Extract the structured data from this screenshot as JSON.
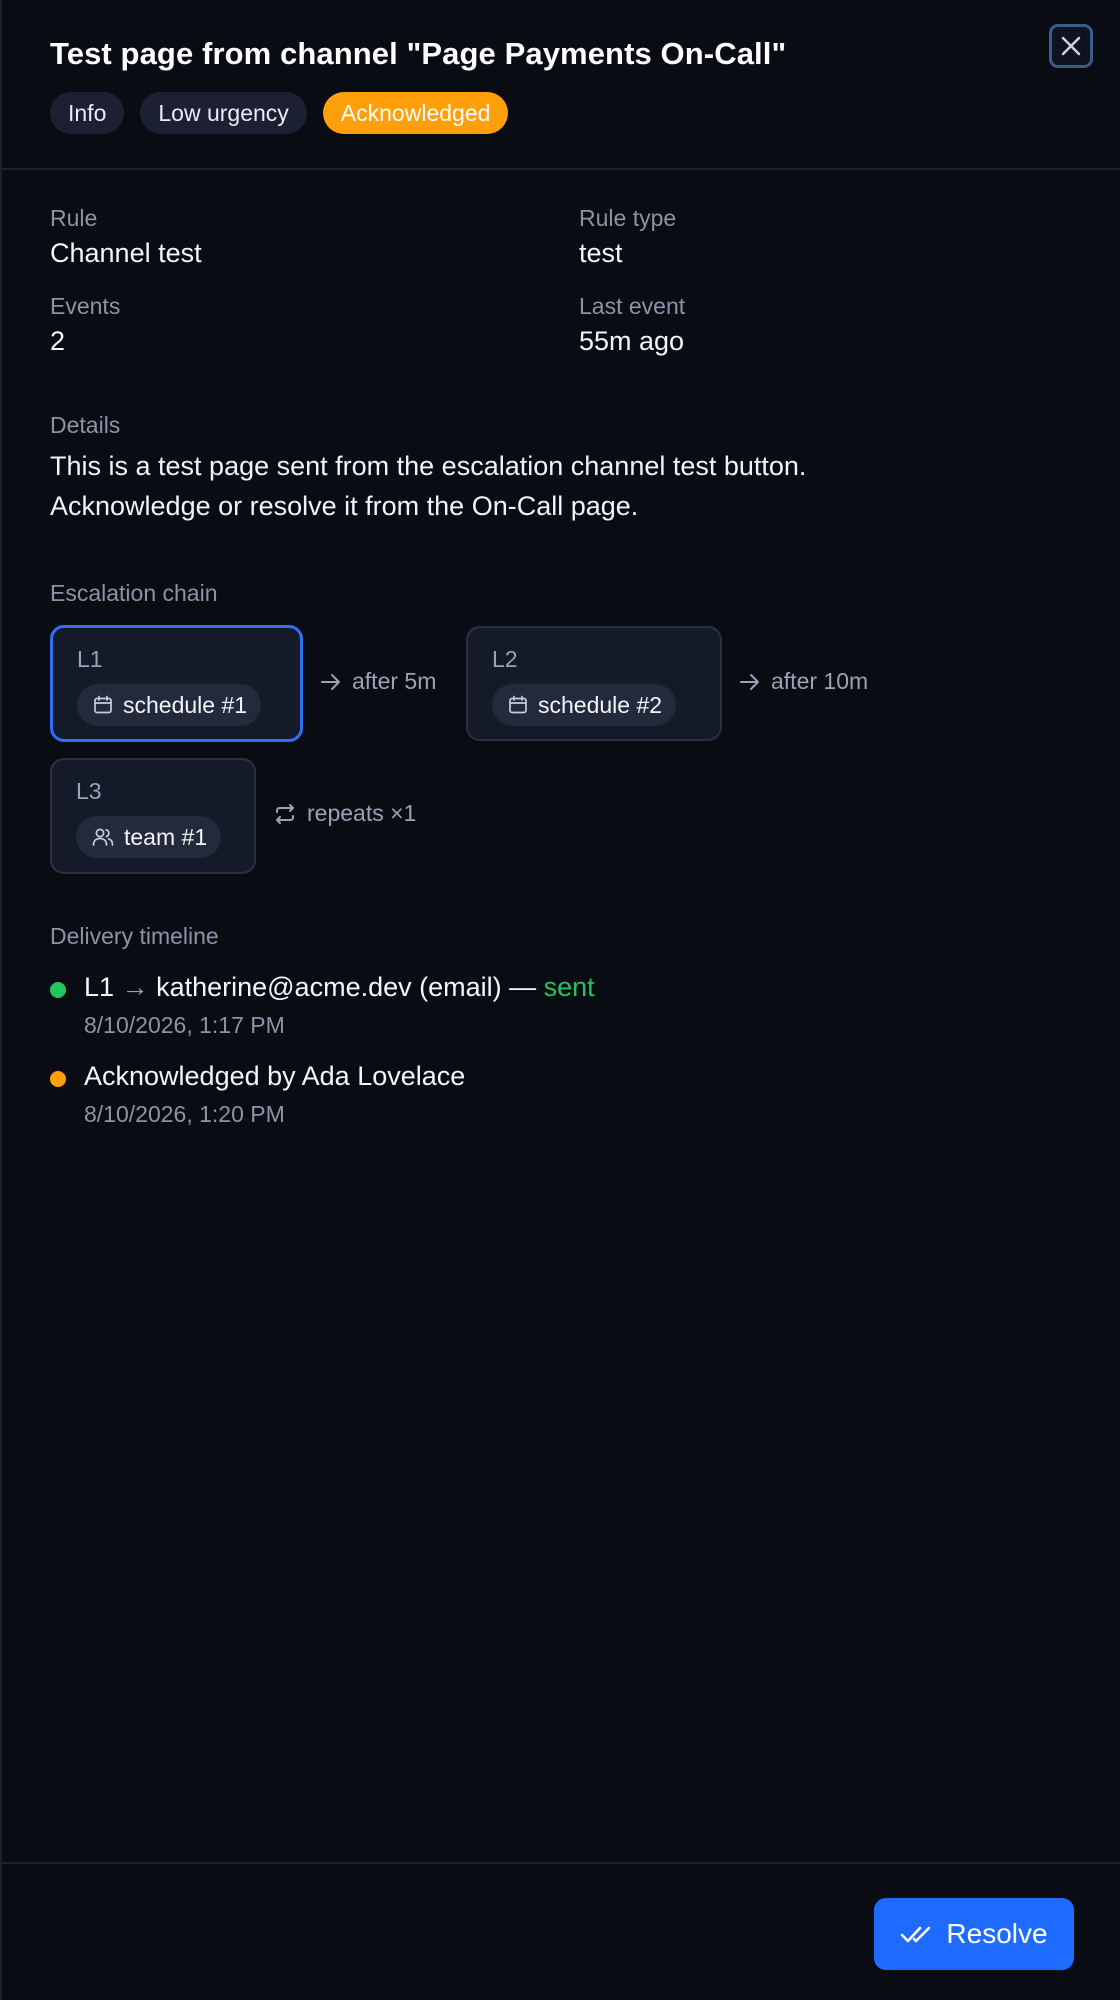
{
  "header": {
    "title": "Test page from channel \"Page Payments On-Call\"",
    "badges": [
      "Info",
      "Low urgency",
      "Acknowledged"
    ],
    "close_icon": "close-icon"
  },
  "meta": {
    "rule_label": "Rule",
    "rule_value": "Channel test",
    "rule_type_label": "Rule type",
    "rule_type_value": "test",
    "events_label": "Events",
    "events_value": "2",
    "last_event_label": "Last event",
    "last_event_value": "55m ago"
  },
  "details": {
    "label": "Details",
    "line1": "This is a test page sent from the escalation channel test button.",
    "line2": "Acknowledge or resolve it from the On-Call page."
  },
  "escalation": {
    "label": "Escalation chain",
    "levels": [
      {
        "level": "L1",
        "target": "schedule #1",
        "icon": "calendar-icon"
      },
      {
        "level": "L2",
        "target": "schedule #2",
        "icon": "calendar-icon"
      },
      {
        "level": "L3",
        "target": "team #1",
        "icon": "users-icon"
      }
    ],
    "connectors": [
      "after 5m",
      "after 10m"
    ],
    "repeats": "repeats ×1"
  },
  "timeline": {
    "label": "Delivery timeline",
    "items": [
      {
        "level": "L1",
        "arrow": "→",
        "recipient": "katherine@acme.dev (email) —",
        "status": "sent",
        "time": "8/10/2026, 1:17 PM",
        "dot_color": "#22c55e",
        "status_color": "#22c55e"
      },
      {
        "text": "Acknowledged by Ada Lovelace",
        "time": "8/10/2026, 1:20 PM",
        "dot_color": "#ff9f0a"
      }
    ]
  },
  "footer": {
    "resolve_label": "Resolve",
    "resolve_icon": "double-check-icon"
  },
  "colors": {
    "accent": "#1f6bff",
    "acknowledged": "#ff9f0a",
    "sent": "#22c55e",
    "background": "#0a0c13"
  }
}
